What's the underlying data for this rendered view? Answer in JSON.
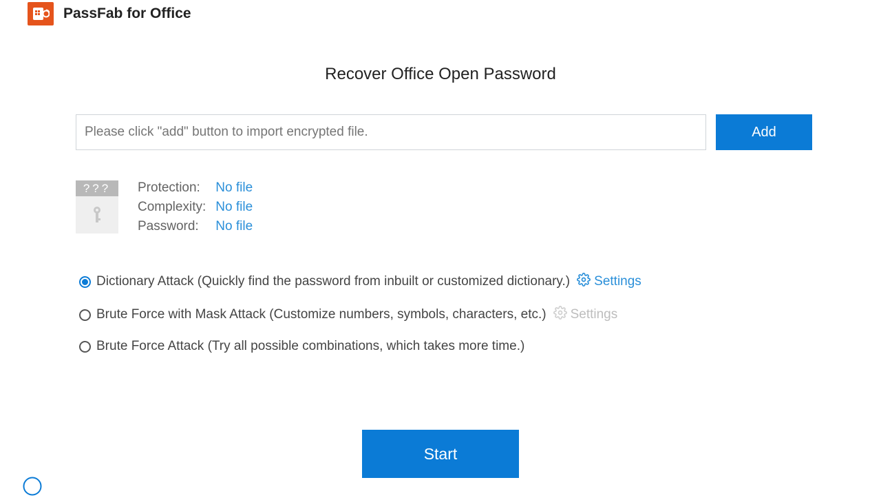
{
  "header": {
    "app_title": "PassFab for Office"
  },
  "page": {
    "title": "Recover Office Open Password"
  },
  "import": {
    "placeholder": "Please click \"add\" button to import encrypted file.",
    "add_label": "Add"
  },
  "file_icon": {
    "top_text": "???"
  },
  "info": {
    "protection_label": "Protection:",
    "protection_value": "No file",
    "complexity_label": "Complexity:",
    "complexity_value": "No file",
    "password_label": "Password:",
    "password_value": "No file"
  },
  "attacks": {
    "dictionary": {
      "label": "Dictionary Attack (Quickly find the password from inbuilt or customized dictionary.)",
      "selected": true,
      "settings_label": "Settings"
    },
    "mask": {
      "label": "Brute Force with Mask Attack (Customize numbers, symbols, characters, etc.)",
      "selected": false,
      "settings_label": "Settings"
    },
    "brute": {
      "label": "Brute Force Attack (Try all possible combinations, which takes more time.)",
      "selected": false
    }
  },
  "actions": {
    "start_label": "Start"
  },
  "colors": {
    "primary": "#0b7bd6",
    "logo": "#e5541c",
    "link": "#2a8fd9"
  }
}
